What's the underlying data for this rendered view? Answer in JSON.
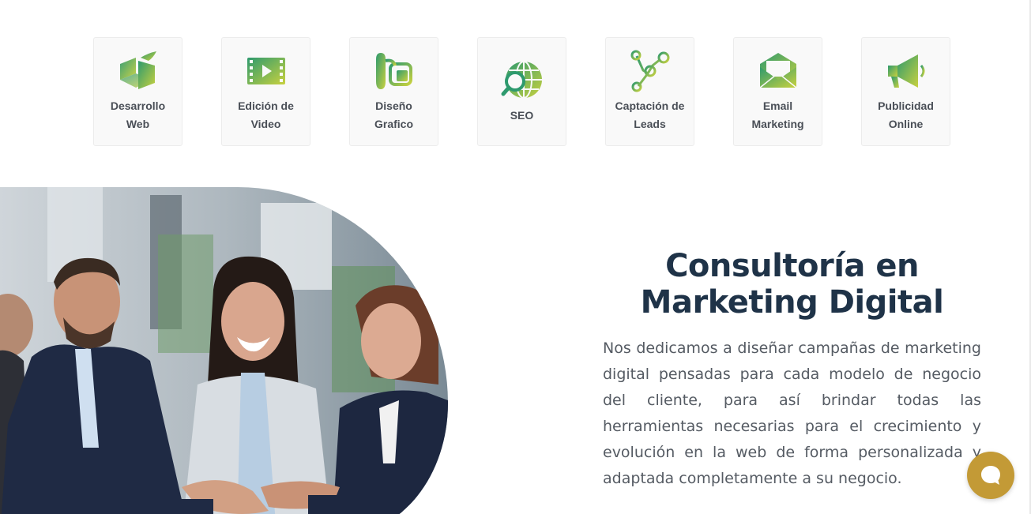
{
  "services": [
    {
      "label": "Desarrollo Web",
      "icon": "cube-web-icon"
    },
    {
      "label": "Edición de Video",
      "icon": "film-strip-icon"
    },
    {
      "label": "Diseño Grafico",
      "icon": "design-tools-icon"
    },
    {
      "label": "SEO",
      "icon": "globe-search-icon"
    },
    {
      "label": "Captación de Leads",
      "icon": "network-nodes-icon"
    },
    {
      "label": "Email Marketing",
      "icon": "envelope-icon"
    },
    {
      "label": "Publicidad Online",
      "icon": "megaphone-icon"
    }
  ],
  "main": {
    "title": "Consultoría en Marketing Digital",
    "body": "Nos dedicamos a diseñar campañas de marketing digital pensadas para cada modelo de negocio del cliente, para así brindar todas las herramientas necesarias para el crecimiento y evolución en la web de forma personalizada y adaptada completamente a su negocio."
  },
  "colors": {
    "icon_gradient_start": "#2e9a6e",
    "icon_gradient_end": "#c8d13f",
    "title": "#1f3348",
    "body_text": "#555b63",
    "chat_button": "#c39a36"
  },
  "chat": {
    "icon": "chat-bubble-icon"
  }
}
